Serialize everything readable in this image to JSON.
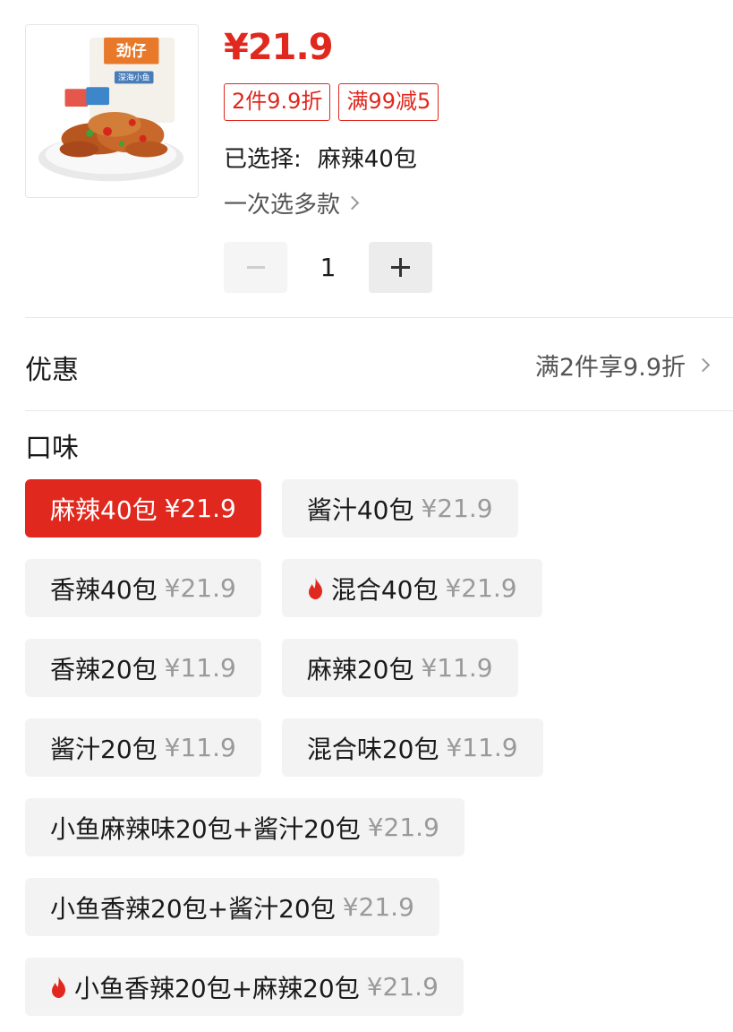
{
  "product": {
    "image_icon": "fish-snack-package-image",
    "brand_text": "劲仔",
    "subtitle_text": "深海小鱼",
    "price": "¥21.9"
  },
  "promotions": [
    "2件9.9折",
    "满99减5"
  ],
  "selection": {
    "label": "已选择:",
    "value": "麻辣40包"
  },
  "multi_select_label": "一次选多款",
  "quantity": "1",
  "discount": {
    "label": "优惠",
    "value": "满2件享9.9折"
  },
  "flavor_label": "口味",
  "options": [
    {
      "name": "麻辣40包",
      "price": "¥21.9",
      "selected": true,
      "hot": false
    },
    {
      "name": "酱汁40包",
      "price": "¥21.9",
      "selected": false,
      "hot": false
    },
    {
      "name": "香辣40包",
      "price": "¥21.9",
      "selected": false,
      "hot": false
    },
    {
      "name": "混合40包",
      "price": "¥21.9",
      "selected": false,
      "hot": true
    },
    {
      "name": "香辣20包",
      "price": "¥11.9",
      "selected": false,
      "hot": false
    },
    {
      "name": "麻辣20包",
      "price": "¥11.9",
      "selected": false,
      "hot": false
    },
    {
      "name": "酱汁20包",
      "price": "¥11.9",
      "selected": false,
      "hot": false
    },
    {
      "name": "混合味20包",
      "price": "¥11.9",
      "selected": false,
      "hot": false
    },
    {
      "name": "小鱼麻辣味20包+酱汁20包",
      "price": "¥21.9",
      "selected": false,
      "hot": false
    },
    {
      "name": "小鱼香辣20包+酱汁20包",
      "price": "¥21.9",
      "selected": false,
      "hot": false
    },
    {
      "name": "小鱼香辣20包+麻辣20包",
      "price": "¥21.9",
      "selected": false,
      "hot": true
    }
  ],
  "colors": {
    "accent": "#e0281e",
    "chip_bg": "#f3f3f3",
    "muted_price": "#9a9a9a"
  }
}
